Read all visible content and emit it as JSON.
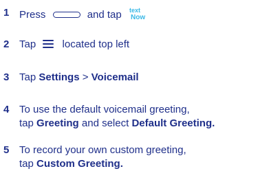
{
  "steps": [
    {
      "number": "1",
      "parts": [
        {
          "text": "Press"
        },
        {
          "icon": "button-outline-icon"
        },
        {
          "text": "and tap"
        },
        {
          "icon": "textnow-logo-icon",
          "logo_text": [
            "text",
            "Now"
          ]
        }
      ]
    },
    {
      "number": "2",
      "parts": [
        {
          "text": "Tap"
        },
        {
          "icon": "hamburger-menu-icon"
        },
        {
          "text": "located top left"
        }
      ]
    },
    {
      "number": "3",
      "line": [
        "Tap ",
        "Settings",
        " > ",
        "Voicemail"
      ]
    },
    {
      "number": "4",
      "line1": "To use the default voicemail greeting,",
      "line2": [
        "tap ",
        "Greeting",
        " and select ",
        "Default Greeting."
      ]
    },
    {
      "number": "5",
      "line1": "To record your own custom greeting,",
      "line2": [
        "tap ",
        "Custom Greeting."
      ]
    }
  ],
  "colors": {
    "text": "#1f2f8a",
    "logo": "#3ab8e6",
    "background": "#ffffff"
  }
}
